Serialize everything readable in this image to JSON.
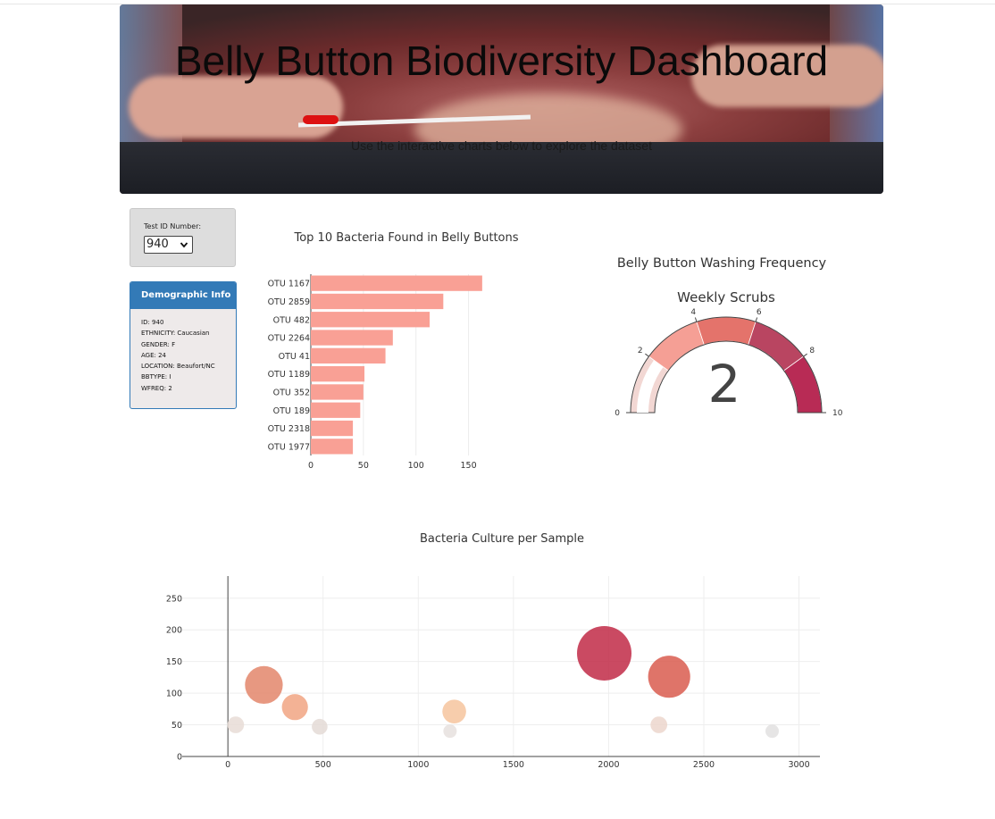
{
  "header": {
    "title": "Belly Button Biodiversity Dashboard",
    "subtitle": "Use the interactive charts below to explore the dataset"
  },
  "selector": {
    "label": "Test ID Number:",
    "value": "940"
  },
  "demographic": {
    "heading": "Demographic Info",
    "lines": [
      "ID: 940",
      "ETHNICITY: Caucasian",
      "GENDER: F",
      "AGE: 24",
      "LOCATION: Beaufort/NC",
      "BBTYPE: I",
      "WFREQ: 2"
    ]
  },
  "colors": {
    "bar": "#f9a095",
    "panel_blue": "#337ab7"
  },
  "chart_data": [
    {
      "type": "bar",
      "orientation": "horizontal",
      "title": "Top 10 Bacteria Found in Belly Buttons",
      "categories": [
        "OTU 1167",
        "OTU 2859",
        "OTU 482",
        "OTU 2264",
        "OTU 41",
        "OTU 1189",
        "OTU 352",
        "OTU 189",
        "OTU 2318",
        "OTU 1977"
      ],
      "values": [
        163,
        126,
        113,
        78,
        71,
        51,
        50,
        47,
        40,
        40
      ],
      "xticks": [
        0,
        50,
        100,
        150
      ],
      "xlim": [
        0,
        171.6
      ],
      "grid": true
    },
    {
      "type": "gauge",
      "title": "Belly Button Washing Frequency",
      "subtitle": "Weekly Scrubs",
      "value": 2,
      "range": [
        0,
        10
      ],
      "ticks": [
        0,
        2,
        4,
        6,
        8,
        10
      ],
      "steps": [
        {
          "range": [
            0,
            2
          ],
          "color": "#f2d7d3"
        },
        {
          "range": [
            2,
            4
          ],
          "color": "#f59f95"
        },
        {
          "range": [
            4,
            6
          ],
          "color": "#e4736b"
        },
        {
          "range": [
            6,
            8
          ],
          "color": "#b94561"
        },
        {
          "range": [
            8,
            10
          ],
          "color": "#b82b55"
        }
      ]
    },
    {
      "type": "scatter",
      "title": "Bacteria Culture per Sample",
      "xlim": [
        -240,
        3110
      ],
      "ylim": [
        0,
        285
      ],
      "xticks": [
        0,
        500,
        1000,
        1500,
        2000,
        2500,
        3000
      ],
      "yticks": [
        0,
        50,
        100,
        150,
        200,
        250
      ],
      "grid": true,
      "points": [
        {
          "x": 41,
          "y": 50,
          "size": 50,
          "color": "#e8dcd6"
        },
        {
          "x": 189,
          "y": 113,
          "size": 113,
          "color": "#e3866b"
        },
        {
          "x": 352,
          "y": 78,
          "size": 78,
          "color": "#f1a583"
        },
        {
          "x": 482,
          "y": 47,
          "size": 47,
          "color": "#e4dad6"
        },
        {
          "x": 1167,
          "y": 40,
          "size": 40,
          "color": "#e6e0de"
        },
        {
          "x": 1189,
          "y": 71,
          "size": 71,
          "color": "#f6c49d"
        },
        {
          "x": 1977,
          "y": 163,
          "size": 163,
          "color": "#c12a46"
        },
        {
          "x": 2264,
          "y": 50,
          "size": 50,
          "color": "#ecd6cc"
        },
        {
          "x": 2318,
          "y": 126,
          "size": 126,
          "color": "#d95c4f"
        },
        {
          "x": 2859,
          "y": 40,
          "size": 40,
          "color": "#e2e0e0"
        }
      ]
    }
  ]
}
